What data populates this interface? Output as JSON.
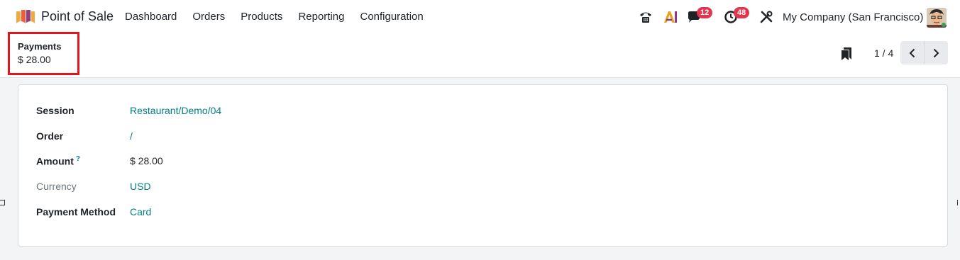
{
  "navbar": {
    "app_name": "Point of Sale",
    "menu": [
      "Dashboard",
      "Orders",
      "Products",
      "Reporting",
      "Configuration"
    ],
    "chat_badge": "12",
    "activity_badge": "48",
    "company": "My Company (San Francisco)"
  },
  "breadcrumb": {
    "title": "Payments",
    "subtitle": "$ 28.00"
  },
  "pager": {
    "value": "1 / 4"
  },
  "form": {
    "session_label": "Session",
    "session_value": "Restaurant/Demo/04",
    "order_label": "Order",
    "order_value": "/",
    "amount_label": "Amount",
    "amount_help": "?",
    "amount_value": "$ 28.00",
    "currency_label": "Currency",
    "currency_value": "USD",
    "payment_method_label": "Payment Method",
    "payment_method_value": "Card"
  },
  "colors": {
    "accent": "#017e84",
    "badge": "#e0364e",
    "highlight": "#e0161f"
  }
}
